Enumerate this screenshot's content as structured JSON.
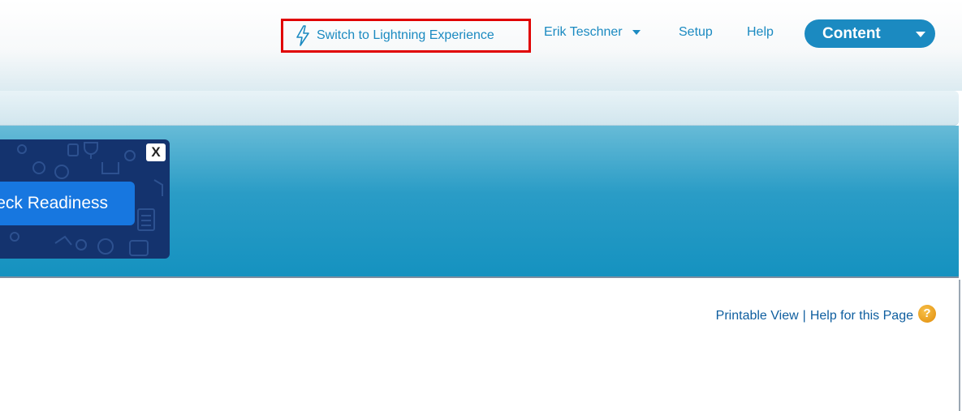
{
  "header": {
    "lightning_link": "Switch to Lightning Experience",
    "user_name": "Erik Teschner",
    "setup": "Setup",
    "help": "Help",
    "app_menu": "Content"
  },
  "readiness_card": {
    "close_label": "X",
    "button_label": "Check Readiness"
  },
  "content": {
    "printable_view": "Printable View",
    "separator": "|",
    "help_for_page": "Help for this Page",
    "help_icon_glyph": "?"
  },
  "colors": {
    "link": "#1b8ac1",
    "highlight_box": "#e00000",
    "app_menu_bg": "#1b8ac1",
    "banner": "#1592c0",
    "card_bg": "#14336e",
    "cta_bg": "#1777e0"
  }
}
